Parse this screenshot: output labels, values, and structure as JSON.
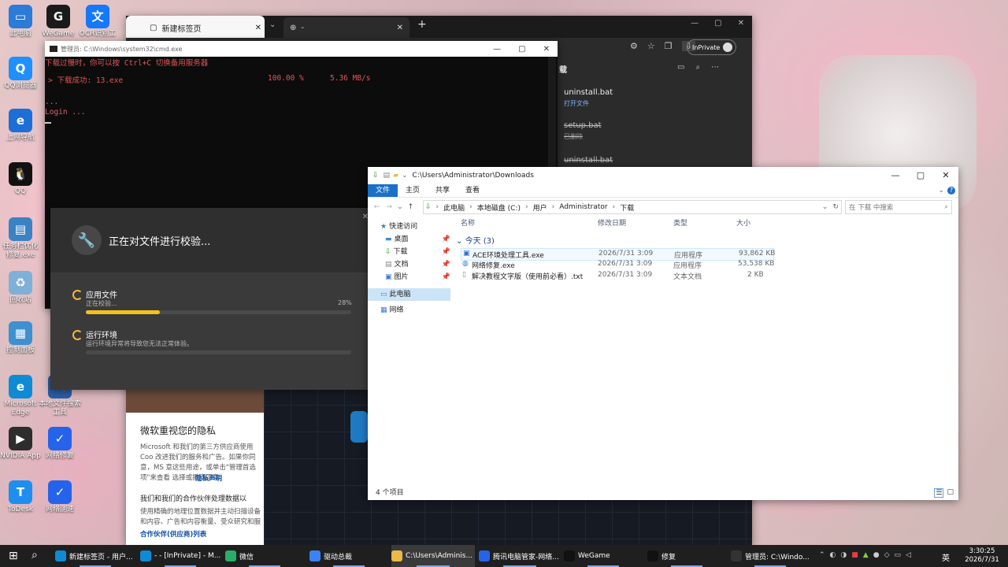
{
  "desktop": {
    "icons": [
      {
        "label": "此电脑",
        "color": "#2b7bd8",
        "glyph": "▭"
      },
      {
        "label": "WeGame",
        "color": "#1a1a1a",
        "glyph": "G"
      },
      {
        "label": "OCR识别工",
        "color": "#1677ff",
        "glyph": "文"
      },
      {
        "label": "QQ浏览器",
        "color": "#1e90ff",
        "glyph": "Q"
      },
      {
        "label": "上网导航",
        "color": "#1d6fd8",
        "glyph": "e"
      },
      {
        "label": "QQ",
        "color": "#111",
        "glyph": "🐧"
      },
      {
        "label": "任务栏优化\n修复.exe",
        "color": "#3b82c4",
        "glyph": "▤"
      },
      {
        "label": "回收站",
        "color": "#7fb0d8",
        "glyph": "♻"
      },
      {
        "label": "控制面板",
        "color": "#3e90d0",
        "glyph": "▦"
      },
      {
        "label": "Microsoft\nEdge",
        "color": "#0f8bd6",
        "glyph": "e"
      },
      {
        "label": "本地文件搜索\n工具",
        "color": "#2a5ea8",
        "glyph": "🔍"
      },
      {
        "label": "NVIDIA App",
        "color": "#2d2d2d",
        "glyph": "▶"
      },
      {
        "label": "网络修复",
        "color": "#2563eb",
        "glyph": "✓"
      },
      {
        "label": "ToDesk",
        "color": "#1f8ef1",
        "glyph": "T"
      },
      {
        "label": "网络测速",
        "color": "#2563eb",
        "glyph": "✓"
      }
    ]
  },
  "edge": {
    "tab1": "新建标签页",
    "tab2": "-",
    "inprivate": "InPrivate",
    "downloads_title": "载",
    "downloads": [
      {
        "name": "uninstall.bat",
        "action": "打开文件",
        "deleted": false
      },
      {
        "name": "setup.bat",
        "action": "已删除",
        "deleted": true
      },
      {
        "name": "uninstall.bat",
        "action": "",
        "deleted": true
      }
    ],
    "privacy_heading": "微软重视您的隐私",
    "privacy_p1": "Microsoft 和我们的第三方供应商使用 Coo 改进我们的服务和广告。如果你同意，MS 意这些用途，或单击\"管理首选项\"来查看 选择或撤回同意。",
    "privacy_link": "隐私声明",
    "privacy_sub": "我们和我们的合作伙伴处理数据以",
    "privacy_p2": "使用精确的地理位置数据并主动扫描设备 和内容、广告和内容衡量、受众研究和服",
    "privacy_link2": "合作伙伴(供应商)列表"
  },
  "cmd": {
    "title": "管理员: C:\\Windows\\system32\\cmd.exe",
    "line1": "下载过慢时，你可以按 Ctrl+C 切换备用服务器",
    "line2_label": "> 下载成功: 13.exe",
    "line2_pct": "100.00 %",
    "line2_speed": "5.36 MB/s",
    "line3": "...",
    "line4": "Login ..."
  },
  "verify": {
    "title": "正在对文件进行校验...",
    "item1_title": "应用文件",
    "item1_status": "正在校验...",
    "item1_pct": "28%",
    "item1_progress": 0.28,
    "item2_title": "运行环境",
    "item2_status": "运行环境异常将导致您无法正常体验。",
    "item2_progress": 0
  },
  "explorer": {
    "title": "C:\\Users\\Administrator\\Downloads",
    "ribbon": [
      "文件",
      "主页",
      "共享",
      "查看"
    ],
    "path": [
      "此电脑",
      "本地磁盘 (C:)",
      "用户",
      "Administrator",
      "下载"
    ],
    "search_placeholder": "在 下载 中搜索",
    "nav": [
      "快速访问",
      "桌面",
      "下载",
      "文档",
      "图片",
      "此电脑",
      "网络"
    ],
    "columns": [
      "名称",
      "修改日期",
      "类型",
      "大小"
    ],
    "group": "今天 (3)",
    "files": [
      {
        "name": "ACE环境处理工具.exe",
        "date": "2026/7/31 3:09",
        "type": "应用程序",
        "size": "93,862 KB"
      },
      {
        "name": "网络修复.exe",
        "date": "2026/7/31 3:09",
        "type": "应用程序",
        "size": "53,538 KB"
      },
      {
        "name": "解决教程文字版（使用前必看）.txt",
        "date": "2026/7/31 3:09",
        "type": "文本文档",
        "size": "2 KB"
      }
    ],
    "status": "4 个项目"
  },
  "taskbar": {
    "items": [
      {
        "label": "新建标签页 - 用户...",
        "color": "#0f8bd6"
      },
      {
        "label": "- - [InPrivate] - M...",
        "color": "#0f8bd6"
      },
      {
        "label": "微信",
        "color": "#2aae67"
      },
      {
        "label": "驱动总裁",
        "color": "#3b82f6"
      },
      {
        "label": "C:\\Users\\Adminis...",
        "color": "#e9b949"
      },
      {
        "label": "腾讯电脑管家-网络...",
        "color": "#2563eb"
      },
      {
        "label": "WeGame",
        "color": "#111"
      },
      {
        "label": "修复",
        "color": "#111"
      },
      {
        "label": "管理员: C:\\Windo...",
        "color": "#333"
      }
    ],
    "ime": "英",
    "time": "3:30:25",
    "date": "2026/7/31"
  }
}
